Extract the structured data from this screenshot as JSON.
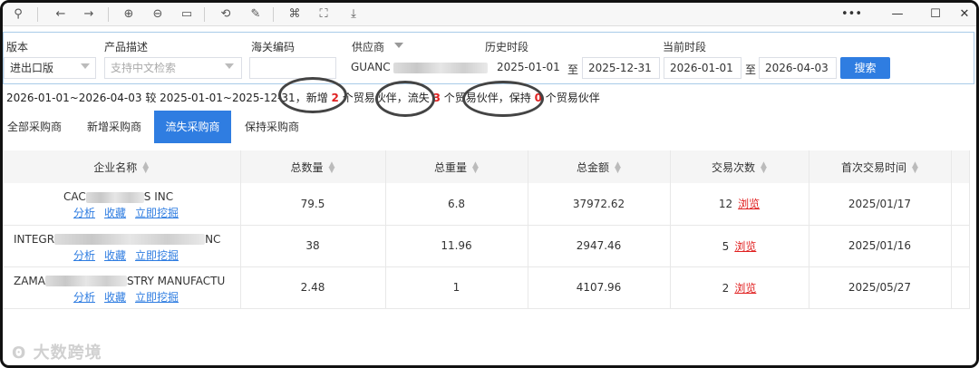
{
  "toolbar": {
    "icons": [
      "pin-icon",
      "back-icon",
      "forward-icon",
      "zoom-in-icon",
      "zoom-out-icon",
      "fit-icon",
      "rotate-icon",
      "edit-icon",
      "translate-icon",
      "scan-icon",
      "download-icon"
    ],
    "window": {
      "more": "•••",
      "minimize": "—",
      "restore": "☐",
      "close": "✕"
    }
  },
  "filter": {
    "version_label": "版本",
    "version_value": "进出口版",
    "product_label": "产品描述",
    "product_placeholder": "支持中文检索",
    "customs_label": "海关编码",
    "customs_value": "",
    "supplier_label": "供应商",
    "supplier_value_prefix": "GUANC",
    "history_label": "历史时段",
    "history_start": "2025-01-01",
    "history_end": "2025-12-31",
    "to_label": "至",
    "current_label": "当前时段",
    "current_start": "2026-01-01",
    "current_end": "2026-04-03",
    "search_button": "搜索"
  },
  "summary": {
    "prefix": "2026-01-01~2026-04-03 较 2025-01-01~2025-12-31，新增",
    "new_count": "2",
    "text_new": "个贸易伙伴，流失",
    "lost_count": "3",
    "text_lost": "个贸易伙伴，保持",
    "kept_count": "0",
    "text_kept": "个贸易伙伴"
  },
  "tabs": [
    "全部采购商",
    "新增采购商",
    "流失采购商",
    "保持采购商"
  ],
  "active_tab": 2,
  "table": {
    "headers": [
      "企业名称",
      "总数量",
      "总重量",
      "总金额",
      "交易次数",
      "首次交易时间"
    ],
    "actions": {
      "analyze": "分析",
      "collect": "收藏",
      "mine": "立即挖掘",
      "browse": "浏览"
    },
    "rows": [
      {
        "name_start": "CAC",
        "name_end": "S INC",
        "quantity": "79.5",
        "weight": "6.8",
        "amount": "37972.62",
        "trades": "12",
        "first_date": "2025/01/17"
      },
      {
        "name_start": "INTEGR",
        "name_end": "NC",
        "quantity": "38",
        "weight": "11.96",
        "amount": "2947.46",
        "trades": "5",
        "first_date": "2025/01/16"
      },
      {
        "name_start": "ZAMA",
        "name_end": "STRY MANUFACTU",
        "quantity": "2.48",
        "weight": "1",
        "amount": "4107.96",
        "trades": "2",
        "first_date": "2025/05/27"
      }
    ]
  },
  "watermark": "大数跨境",
  "colors": {
    "accent": "#2f7de1",
    "highlight": "#e02020"
  }
}
